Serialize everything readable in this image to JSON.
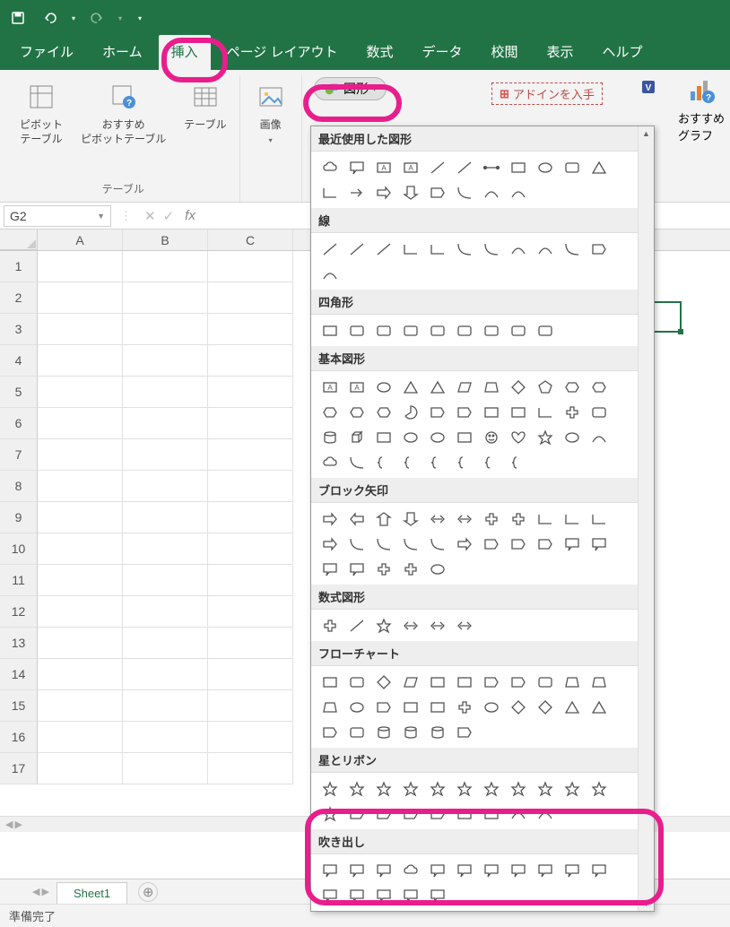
{
  "titlebar": {},
  "tabs": [
    "ファイル",
    "ホーム",
    "挿入",
    "ページ レイアウト",
    "数式",
    "データ",
    "校閲",
    "表示",
    "ヘルプ"
  ],
  "active_tab_index": 2,
  "ribbon": {
    "pivot": "ピボット\nテーブル",
    "recommend_pivot": "おすすめ\nピボットテーブル",
    "table": "テーブル",
    "group_tables": "テーブル",
    "pictures": "画像",
    "shapes_btn": "図形",
    "addins": "アドインを入手",
    "rec_chart": "おすすめ\nグラフ"
  },
  "namebox": "G2",
  "columns": [
    "A",
    "B",
    "C"
  ],
  "rows": [
    "1",
    "2",
    "3",
    "4",
    "5",
    "6",
    "7",
    "8",
    "9",
    "10",
    "11",
    "12",
    "13",
    "14",
    "15",
    "16",
    "17"
  ],
  "gallery": {
    "s1": "最近使用した図形",
    "s2": "線",
    "s3": "四角形",
    "s4": "基本図形",
    "s5": "ブロック矢印",
    "s6": "数式図形",
    "s7": "フローチャート",
    "s8": "星とリボン",
    "s9": "吹き出し"
  },
  "sheet_tab": "Sheet1",
  "status": "準備完了"
}
